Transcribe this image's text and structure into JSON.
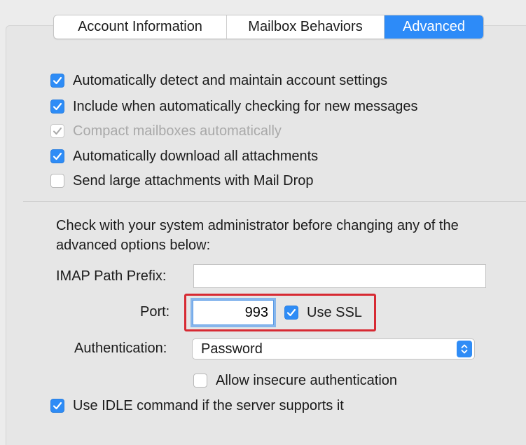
{
  "tabs": {
    "account": "Account Information",
    "mailbox": "Mailbox Behaviors",
    "advanced": "Advanced"
  },
  "options": {
    "auto_detect": {
      "label": "Automatically detect and maintain account settings",
      "checked": true
    },
    "include_check": {
      "label": "Include when automatically checking for new messages",
      "checked": true
    },
    "compact": {
      "label": "Compact mailboxes automatically",
      "checked": true,
      "disabled": true
    },
    "download_attachments": {
      "label": "Automatically download all attachments",
      "checked": true
    },
    "mail_drop": {
      "label": "Send large attachments with Mail Drop",
      "checked": false
    }
  },
  "notice": "Check with your system administrator before changing any of the advanced options below:",
  "imap": {
    "label": "IMAP Path Prefix:",
    "value": ""
  },
  "port": {
    "label": "Port:",
    "value": "993",
    "ssl_label": "Use SSL",
    "ssl_checked": true
  },
  "auth": {
    "label": "Authentication:",
    "value": "Password",
    "insecure_label": "Allow insecure authentication",
    "insecure_checked": false
  },
  "idle": {
    "label": "Use IDLE command if the server supports it",
    "checked": true
  },
  "colors": {
    "accent": "#2d8bf8",
    "highlight": "#d72a33",
    "background": "#ececec"
  },
  "icons": {
    "check": "checkmark-icon",
    "stepper": "up-down-chevron-icon"
  }
}
